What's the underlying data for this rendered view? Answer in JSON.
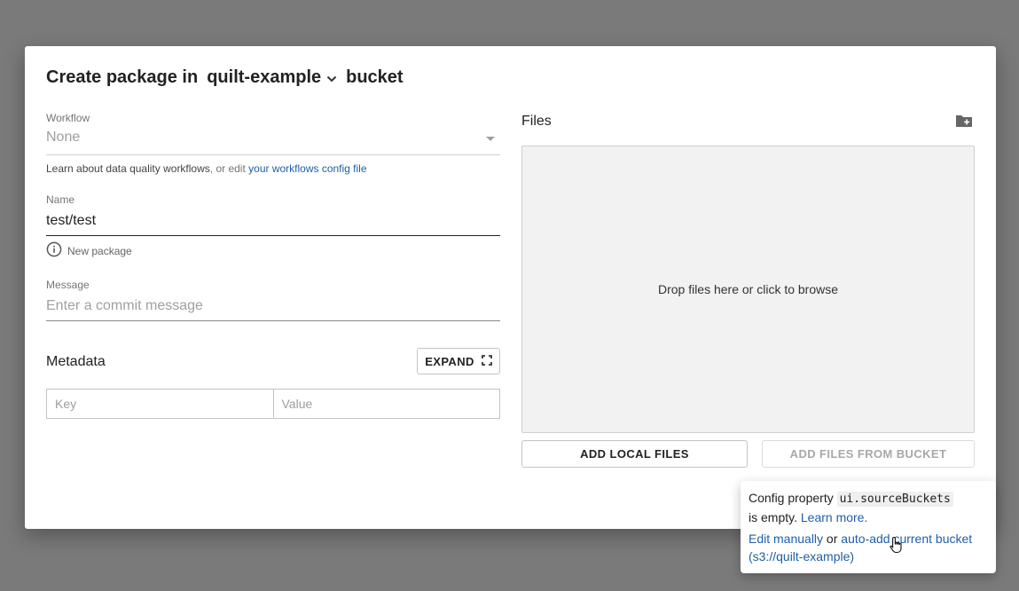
{
  "header": {
    "prefix": "Create package in",
    "bucket": "quilt-example",
    "suffix": "bucket"
  },
  "workflow": {
    "label": "Workflow",
    "value": "None",
    "help_text": "Learn about data quality workflows",
    "help_mid": ", or edit ",
    "help_link": "your workflows config file"
  },
  "name": {
    "label": "Name",
    "value": "test/test",
    "hint": "New package"
  },
  "message": {
    "label": "Message",
    "placeholder": "Enter a commit message"
  },
  "metadata": {
    "title": "Metadata",
    "expand_label": "EXPAND",
    "key_placeholder": "Key",
    "value_placeholder": "Value"
  },
  "files": {
    "title": "Files",
    "drop_text": "Drop files here or click to browse",
    "add_local_label": "ADD LOCAL FILES",
    "add_bucket_label": "ADD FILES FROM BUCKET"
  },
  "popover": {
    "text_before": "Config property ",
    "code": "ui.sourceBuckets",
    "text_after": "is empty. ",
    "learn_more": "Learn more.",
    "edit_manually": "Edit manually",
    "or": " or ",
    "auto_add": "auto-add current bucket (s3://quilt-example)"
  },
  "icons": {
    "bucket_dropdown": "chevron-down-icon",
    "info": "info-icon",
    "expand": "fullscreen-icon",
    "add_folder": "create-new-folder-icon",
    "pointer": "hand-pointer-icon"
  },
  "colors": {
    "link": "#1e5fa8",
    "overlay": "#7a7a7a",
    "dropzone": "#f2f2f2"
  }
}
